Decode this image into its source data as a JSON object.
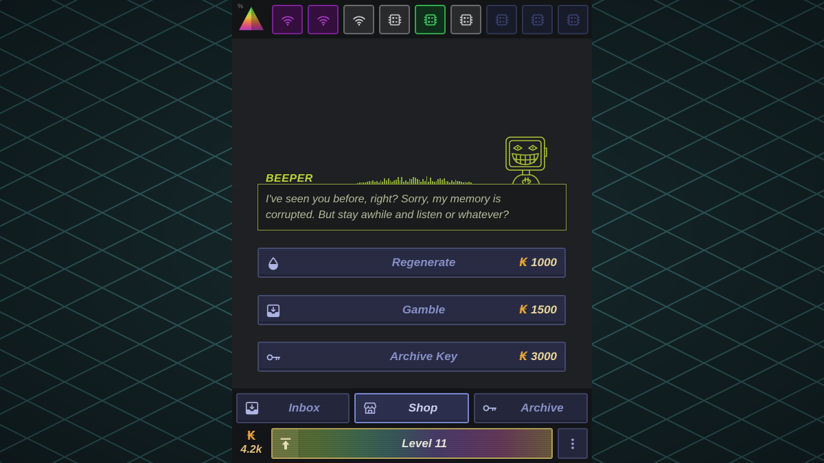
{
  "top_bar": {
    "corner_mark": "%",
    "core_icon": "rainbow-pyramid-icon",
    "slots": [
      {
        "icon": "wifi-icon",
        "bg": "#36103f",
        "border": "#7d2396",
        "glyph": "#b13ccc"
      },
      {
        "icon": "wifi-icon",
        "bg": "#36103f",
        "border": "#7d2396",
        "glyph": "#b13ccc"
      },
      {
        "icon": "wifi-icon",
        "bg": "#2b2c2e",
        "border": "#6b6c70",
        "glyph": "#d8d8d8"
      },
      {
        "icon": "chip-icon",
        "bg": "#2b2c2e",
        "border": "#6b6c70",
        "glyph": "#cfcfcf"
      },
      {
        "icon": "chip-icon",
        "bg": "#10301a",
        "border": "#2fae4e",
        "glyph": "#46d46a"
      },
      {
        "icon": "chip-icon",
        "bg": "#2b2c2e",
        "border": "#6b6c70",
        "glyph": "#cfcfcf"
      },
      {
        "icon": "chip-icon",
        "bg": "#191c2a",
        "border": "#2f3552",
        "glyph": "#3c4571"
      },
      {
        "icon": "chip-icon",
        "bg": "#191c2a",
        "border": "#2f3552",
        "glyph": "#3c4571"
      },
      {
        "icon": "chip-icon",
        "bg": "#191c2a",
        "border": "#2f3552",
        "glyph": "#3c4571"
      }
    ]
  },
  "dialog": {
    "speaker": "BEEPER",
    "lines": [
      "I've seen you before, right? Sorry, my memory is",
      "corrupted. But stay awhile and listen or whatever?"
    ]
  },
  "shop_items": [
    {
      "icon": "droplet-icon",
      "label": "Regenerate",
      "currency_symbol": "₭",
      "price": "1000"
    },
    {
      "icon": "inbox-download-icon",
      "label": "Gamble",
      "currency_symbol": "₭",
      "price": "1500"
    },
    {
      "icon": "key-icon",
      "label": "Archive Key",
      "currency_symbol": "₭",
      "price": "3000"
    }
  ],
  "nav_tabs": [
    {
      "icon": "inbox-icon",
      "label": "Inbox",
      "selected": false
    },
    {
      "icon": "store-icon",
      "label": "Shop",
      "selected": true
    },
    {
      "icon": "key-icon",
      "label": "Archive",
      "selected": false
    }
  ],
  "status_bar": {
    "currency_symbol": "₭",
    "balance": "4.2k",
    "level_icon": "level-up-icon",
    "level_label": "Level 11",
    "menu_icon": "more-vertical-icon"
  },
  "colors": {
    "background": "#132326",
    "grid_line": "#2d5558",
    "panel": "#1f2124",
    "speaker_name": "#c5da3a",
    "dialog_border": "#8d9b3a",
    "dialog_text": "#b8bf9f",
    "character_line": "#b0c43a",
    "button_bg": "#292c45",
    "button_border": "#454a6f",
    "button_text": "#8b93cc",
    "button_icon": "#b4bbea",
    "currency": "#e6a93e",
    "price_text": "#f1dca2",
    "tab_selected_border": "#7a8ad6",
    "tab_selected_text": "#d2d8f4",
    "level_bar_border": "#b5a35a",
    "level_text": "#ecebe0",
    "balance_text": "#e9c47a"
  }
}
